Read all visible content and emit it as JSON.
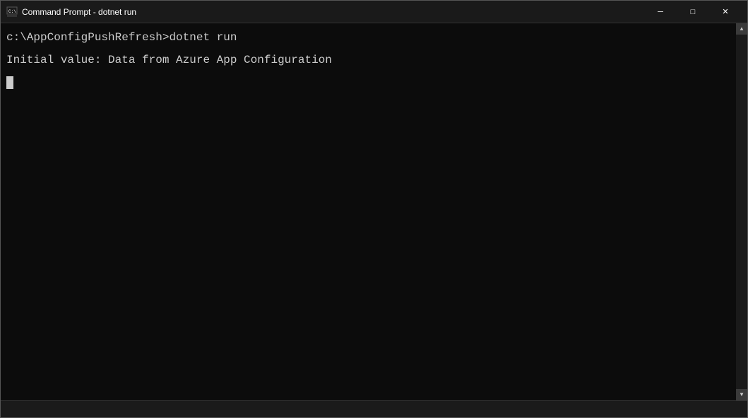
{
  "window": {
    "title": "Command Prompt - dotnet  run",
    "icon": "cmd-icon"
  },
  "titlebar": {
    "minimize_label": "─",
    "maximize_label": "□",
    "close_label": "✕"
  },
  "terminal": {
    "line1": "c:\\AppConfigPushRefresh>dotnet run",
    "line2": "Initial value: Data from Azure App Configuration",
    "bottom_text": ""
  }
}
